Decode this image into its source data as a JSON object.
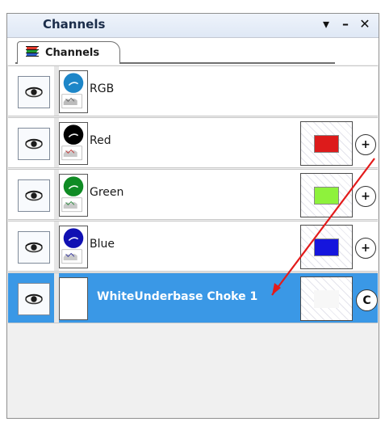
{
  "panel": {
    "title": "Channels",
    "controls": {
      "menu": "▾",
      "minimize": "–",
      "close": "✕"
    }
  },
  "tab": {
    "label": "Channels",
    "icon": "channels-stack-icon"
  },
  "channels": [
    {
      "name": "RGB",
      "thumb": "rgb",
      "swatch": null,
      "button": null
    },
    {
      "name": "Red",
      "thumb": "red",
      "swatch": "#dd1b1b",
      "button": "+"
    },
    {
      "name": "Green",
      "thumb": "green",
      "swatch": "#8ef23c",
      "button": "+"
    },
    {
      "name": "Blue",
      "thumb": "blue",
      "swatch": "#1515dd",
      "button": "+"
    },
    {
      "name": "WhiteUnderbase Choke 1",
      "thumb": "white",
      "swatch": "#f7f7f7",
      "button": "C",
      "selected": true
    }
  ],
  "colors": {
    "selected_row": "#3a98e6",
    "annotation_arrow": "#e31b1b"
  }
}
